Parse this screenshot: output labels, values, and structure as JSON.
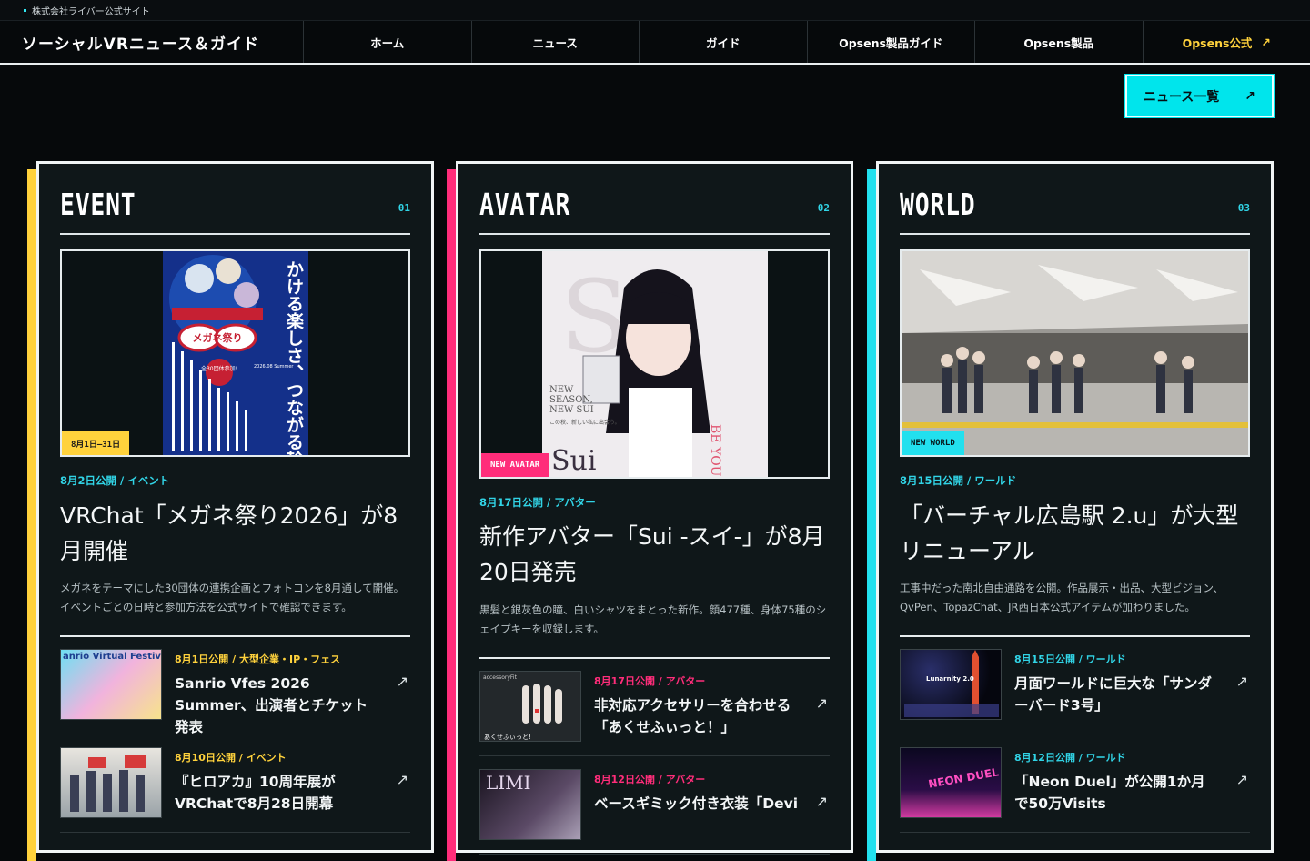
{
  "topbar": {
    "text": "株式会社ライバー公式サイト"
  },
  "nav": {
    "brand": "ソーシャルVRニュース＆ガイド",
    "items": [
      "ホーム",
      "ニュース",
      "ガイド",
      "Opsens製品ガイド",
      "Opsens製品"
    ],
    "official": "Opsens公式",
    "official_arrow": "↗"
  },
  "list_button": {
    "label": "ニュース一覧",
    "arrow": "↗"
  },
  "colors": {
    "event": "#ffd23c",
    "avatar": "#ff2d7a",
    "world": "#22e0ee"
  },
  "columns": [
    {
      "label": "EVENT",
      "num": "01",
      "badge": "8月1日—31日",
      "meta": "8月2日公開 / イベント",
      "title": "VRChat「メガネ祭り2026」が8月開催",
      "desc": "メガネをテーマにした30団体の連携企画とフォトコンを8月通して開催。イベントごとの日時と参加方法を公式サイトで確認できます。",
      "poster": {
        "text": "かける楽しさ、つながる輪",
        "name": "メガネ祭り",
        "sub": "全30団体参加!",
        "year": "2026.08 Summer"
      },
      "subs": [
        {
          "meta": "8月1日公開 / 大型企業・IP・フェス",
          "title": "Sanrio Vfes 2026 Summer、出演者とチケット発表",
          "thumb_text": "anrio Virtual Festiva",
          "arrow": "↗"
        },
        {
          "meta": "8月10日公開 / イベント",
          "title": "『ヒロアカ』10周年展がVRChatで8月28日開幕",
          "arrow": "↗"
        }
      ]
    },
    {
      "label": "AVATAR",
      "num": "02",
      "badge": "NEW AVATAR",
      "meta": "8月17日公開 / アバター",
      "title": "新作アバター「Sui -スイ-」が8月20日発売",
      "desc": "黒髪と銀灰色の瞳、白いシャツをまとった新作。顔477種、身体75種のシェイプキーを収録します。",
      "poster": {
        "name": "Sui",
        "lines": [
          "NEW",
          "SEASON,",
          "NEW SUI"
        ],
        "caption": "この秋、新しい私に出会う。",
        "slogan": "BE YOUR OWN MUSE."
      },
      "subs": [
        {
          "meta": "8月17日公開 / アバター",
          "title": "非対応アクセサリーを合わせる「あくせふぃっと！」",
          "thumb_text": "あくせふぃっと!",
          "thumb_label": "accessoryFit",
          "arrow": "↗"
        },
        {
          "meta": "8月12日公開 / アバター",
          "title": "ベースギミック付き衣装「Devi",
          "thumb_text": "LIMI",
          "arrow": "↗"
        }
      ]
    },
    {
      "label": "WORLD",
      "num": "03",
      "badge": "NEW WORLD",
      "meta": "8月15日公開 / ワールド",
      "title": "「バーチャル広島駅 2.u」が大型リニューアル",
      "desc": "工事中だった南北自由通路を公開。作品展示・出品、大型ビジョン、QvPen、TopazChat、JR西日本公式アイテムが加わりました。",
      "subs": [
        {
          "meta": "8月15日公開 / ワールド",
          "title": "月面ワールドに巨大な「サンダーバード3号」",
          "thumb_text": "Lunarnity 2.0",
          "arrow": "↗"
        },
        {
          "meta": "8月12日公開 / ワールド",
          "title": "「Neon Duel」が公開1か月で50万Visits",
          "thumb_text": "NEON DUEL",
          "arrow": "↗"
        }
      ]
    }
  ]
}
